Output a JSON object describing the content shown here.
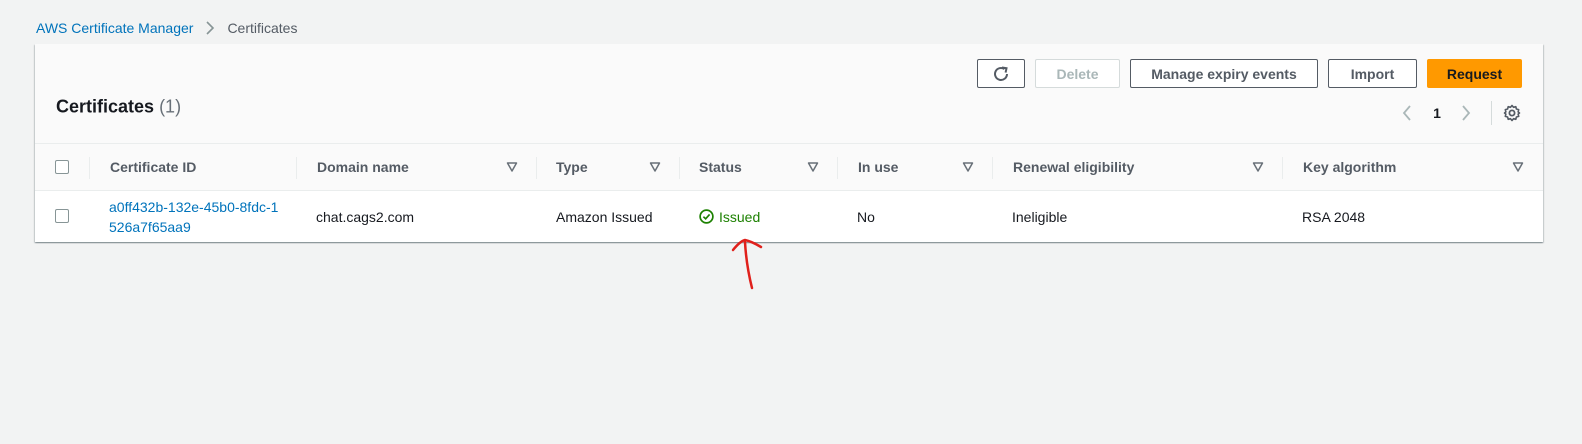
{
  "breadcrumb": {
    "parent": "AWS Certificate Manager",
    "current": "Certificates"
  },
  "header": {
    "title": "Certificates",
    "count": "(1)"
  },
  "toolbar": {
    "delete_label": "Delete",
    "manage_expiry_label": "Manage expiry events",
    "import_label": "Import",
    "request_label": "Request",
    "refresh_icon": "refresh-icon"
  },
  "pagination": {
    "current_page": "1"
  },
  "table": {
    "columns": [
      {
        "label": "Certificate ID",
        "sortable": false
      },
      {
        "label": "Domain name",
        "sortable": true
      },
      {
        "label": "Type",
        "sortable": true
      },
      {
        "label": "Status",
        "sortable": true
      },
      {
        "label": "In use",
        "sortable": true
      },
      {
        "label": "Renewal eligibility",
        "sortable": true
      },
      {
        "label": "Key algorithm",
        "sortable": true
      }
    ],
    "rows": [
      {
        "certificate_id": "a0ff432b-132e-45b0-8fdc-1526a7f65aa9",
        "domain_name": "chat.cags2.com",
        "type": "Amazon Issued",
        "status": "Issued",
        "in_use": "No",
        "renewal_eligibility": "Ineligible",
        "key_algorithm": "RSA 2048"
      }
    ]
  },
  "colors": {
    "link": "#0073bb",
    "primary": "#ff9900",
    "success": "#1d8102",
    "annotation": "#e0201b"
  }
}
